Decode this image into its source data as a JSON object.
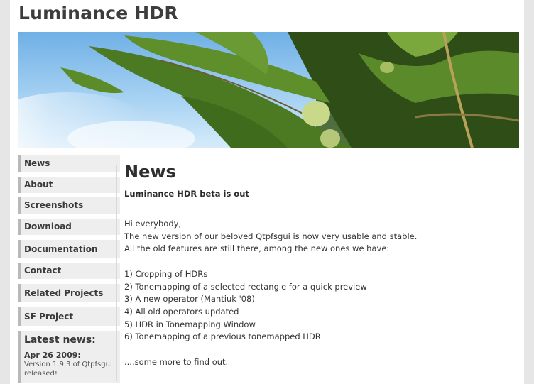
{
  "site": {
    "title": "Luminance HDR"
  },
  "sidebar": {
    "items": [
      {
        "label": "News"
      },
      {
        "label": "About"
      },
      {
        "label": "Screenshots"
      },
      {
        "label": "Download"
      },
      {
        "label": "Documentation"
      },
      {
        "label": "Contact"
      },
      {
        "label": "Related Projects"
      },
      {
        "label": "SF Project"
      }
    ],
    "latest_news": {
      "heading": "Latest news:",
      "date": "Apr 26 2009:",
      "text": "Version 1.9.3 of Qtpfsgui released!"
    }
  },
  "main": {
    "title": "News",
    "subtitle": "Luminance HDR beta is out",
    "paragraph1": [
      "Hi everybody,",
      "The new version of our beloved Qtpfsgui is now very usable and stable.",
      "All the old features are still there, among the new ones we have:"
    ],
    "features": [
      "1) Cropping of HDRs",
      "2) Tonemapping of a selected rectangle for a quick preview",
      "3) A new operator (Mantiuk '08)",
      "4) All old operators updated",
      "5) HDR in Tonemapping Window",
      "6) Tonemapping of a previous tonemapped HDR"
    ],
    "closing": "....some more to find out."
  }
}
